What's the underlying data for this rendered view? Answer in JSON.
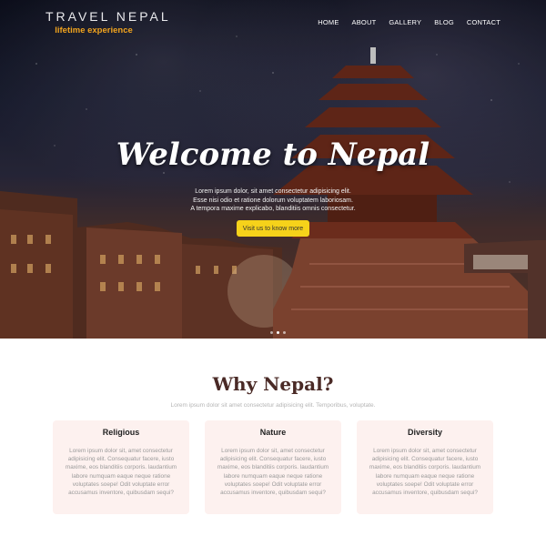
{
  "logo": {
    "title": "TRAVEL NEPAL",
    "tagline": "lifetime experience"
  },
  "nav": [
    {
      "label": "HOME"
    },
    {
      "label": "ABOUT"
    },
    {
      "label": "GALLERY"
    },
    {
      "label": "BLOG"
    },
    {
      "label": "CONTACT"
    }
  ],
  "hero": {
    "title": "Welcome to Nepal",
    "text_lines": [
      "Lorem ipsum dolor, sit amet consectetur adipisicing elit.",
      "Esse nisi odio et ratione dolorum voluptatem laboriosam.",
      "A tempora maxime explicabo, blanditiis omnis consectetur."
    ],
    "cta_label": "Visit us to know more",
    "carousel_dots": 3,
    "active_dot": 1
  },
  "why": {
    "title": "Why Nepal?",
    "subtitle": "Lorem ipsum dolor sit amet consectetur adipisicing elit. Temporibus, voluptate.",
    "cards": [
      {
        "title": "Religious",
        "lines": [
          "Lorem ipsum dolor sit, amet consectetur",
          "adipisicing elit. Consequatur facere, iusto",
          "maxime, eos blanditiis corporis. laudantium",
          "labore numquam eaque neque ratione",
          "voluptates soepe! Odit voluptate error",
          "accusamus inventore, quibusdam sequi?"
        ]
      },
      {
        "title": "Nature",
        "lines": [
          "Lorem ipsum dolor sit, amet consectetur",
          "adipisicing elit. Consequatur facere, iusto",
          "maxime, eos blanditiis corporis. laudantium",
          "labore numquam eaque neque ratione",
          "voluptates soepe! Odit voluptate error",
          "accusamus inventore, quibusdam sequi?"
        ]
      },
      {
        "title": "Diversity",
        "lines": [
          "Lorem ipsum dolor sit, amet consectetur",
          "adipisicing elit. Consequatur facere, iusto",
          "maxime, eos blanditiis corporis. laudantium",
          "labore numquam eaque neque ratione",
          "voluptates soepe! Odit voluptate error",
          "accusamus inventore, quibusdam sequi?"
        ]
      }
    ]
  },
  "colors": {
    "accent": "#f0a31e",
    "cta": "#f6d21a",
    "card_bg": "#fdf1ef",
    "heading": "#4a2a26"
  }
}
